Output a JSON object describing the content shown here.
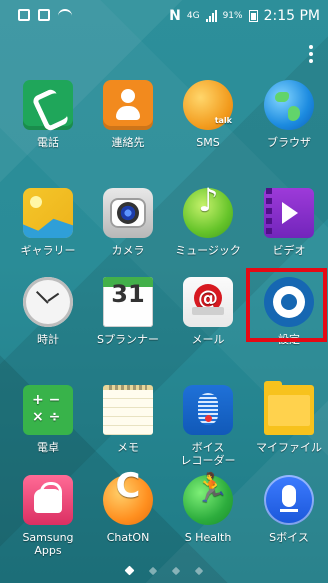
{
  "status_bar": {
    "time": "2:15 PM",
    "battery": "91%",
    "network": "4G"
  },
  "apps": [
    {
      "label": "電話",
      "icon": "phone-icon"
    },
    {
      "label": "連絡先",
      "icon": "contacts-icon"
    },
    {
      "label": "SMS",
      "icon": "sms-icon"
    },
    {
      "label": "ブラウザ",
      "icon": "browser-icon"
    },
    {
      "label": "ギャラリー",
      "icon": "gallery-icon"
    },
    {
      "label": "カメラ",
      "icon": "camera-icon"
    },
    {
      "label": "ミュージック",
      "icon": "music-icon"
    },
    {
      "label": "ビデオ",
      "icon": "video-icon"
    },
    {
      "label": "時計",
      "icon": "clock-icon"
    },
    {
      "label": "Sプランナー",
      "icon": "planner-icon",
      "badge": "31"
    },
    {
      "label": "メール",
      "icon": "mail-icon"
    },
    {
      "label": "設定",
      "icon": "settings-icon"
    },
    {
      "label": "電卓",
      "icon": "calculator-icon"
    },
    {
      "label": "メモ",
      "icon": "memo-icon"
    },
    {
      "label": "ボイス\nレコーダー",
      "icon": "voice-recorder-icon"
    },
    {
      "label": "マイファイル",
      "icon": "my-files-icon"
    },
    {
      "label": "Samsung\nApps",
      "icon": "samsung-apps-icon"
    },
    {
      "label": "ChatON",
      "icon": "chaton-icon"
    },
    {
      "label": "S Health",
      "icon": "s-health-icon"
    },
    {
      "label": "Sボイス",
      "icon": "s-voice-icon"
    }
  ],
  "pages": {
    "count": 4,
    "active": 1
  }
}
